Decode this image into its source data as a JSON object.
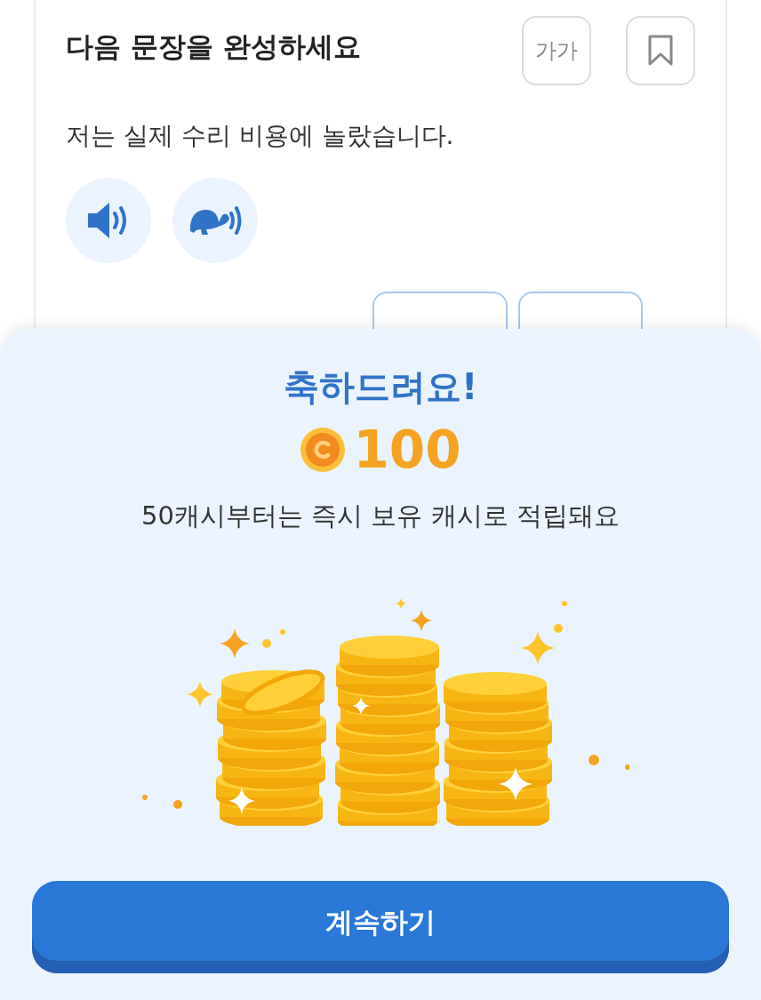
{
  "question": {
    "title": "다음 문장을 완성하세요",
    "font_button": "가가",
    "sentence": "저는 실제 수리 비용에 놀랐습니다."
  },
  "reward": {
    "title": "축하드려요!",
    "amount": "100",
    "message": "50캐시부터는 즉시 보유 캐시로 적립돼요"
  },
  "continue_button": "계속하기"
}
